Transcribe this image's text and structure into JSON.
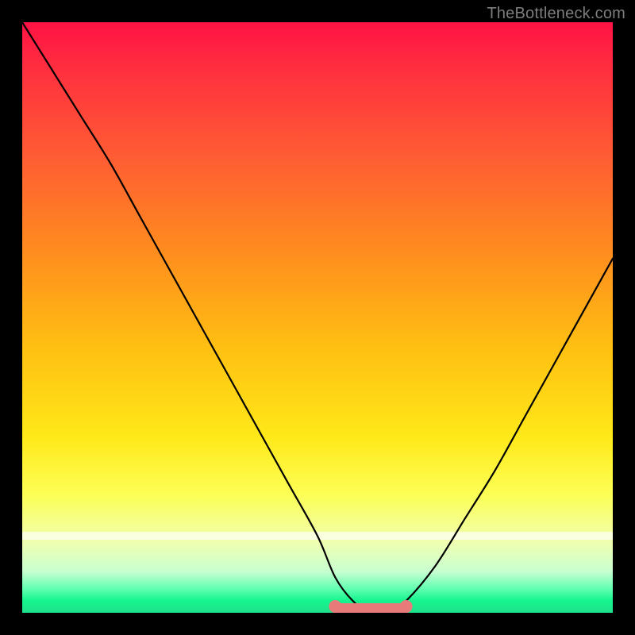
{
  "watermark": "TheBottleneck.com",
  "colors": {
    "background": "#000000",
    "curve": "#000000",
    "flat_segment": "#e97a7a",
    "gradient_top": "#ff1244",
    "gradient_bottom": "#20e08c"
  },
  "chart_data": {
    "type": "line",
    "title": "",
    "xlabel": "",
    "ylabel": "",
    "xlim": [
      0,
      100
    ],
    "ylim": [
      0,
      100
    ],
    "grid": false,
    "series": [
      {
        "name": "curve",
        "x": [
          0,
          5,
          10,
          15,
          20,
          25,
          30,
          35,
          40,
          45,
          50,
          53,
          56,
          59,
          62,
          65,
          70,
          75,
          80,
          85,
          90,
          95,
          100
        ],
        "values": [
          100,
          92,
          84,
          76,
          67,
          58,
          49,
          40,
          31,
          22,
          13,
          6,
          2,
          0,
          0,
          2,
          8,
          16,
          24,
          33,
          42,
          51,
          60
        ]
      }
    ],
    "flat_segment": {
      "x_start": 53,
      "x_end": 65,
      "y": 0
    }
  }
}
